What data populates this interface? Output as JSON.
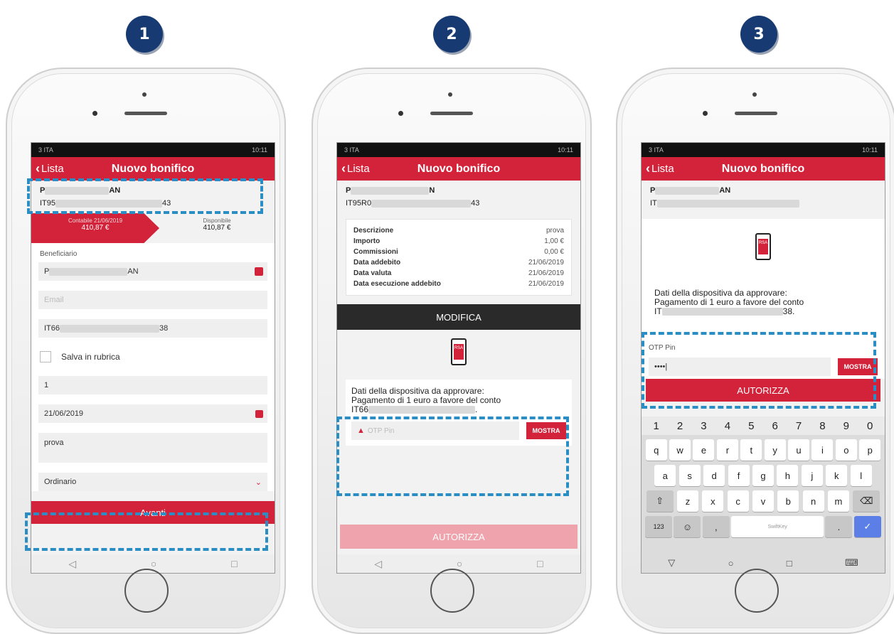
{
  "steps": [
    "1",
    "2",
    "3"
  ],
  "app": {
    "status_left": "3 ITA",
    "status_right": "10:11",
    "back_label": "Lista",
    "title": "Nuovo bonifico"
  },
  "screen1": {
    "account_name_start": "P",
    "account_name_end": "AN",
    "iban_start": "IT95",
    "iban_end": "43",
    "contabile_label": "Contabile 21/06/2019",
    "contabile_value": "410,87 €",
    "disponibile_label": "Disponibile",
    "disponibile_value": "410,87 €",
    "beneficiario_label": "Beneficiario",
    "beneficiario_value_start": "P",
    "beneficiario_value_end": "AN",
    "email_placeholder": "Email",
    "iban_field_start": "IT66",
    "iban_field_end": "38",
    "salva_label": "Salva in rubrica",
    "importo_value": "1",
    "date_value": "21/06/2019",
    "causale_value": "prova",
    "tipo_value": "Ordinario",
    "avanti_label": "Avanti"
  },
  "screen2": {
    "account_name_start": "P",
    "account_name_end": "N",
    "iban_start": "IT95R0",
    "iban_end": "43",
    "details": [
      {
        "k": "Descrizione",
        "v": "prova"
      },
      {
        "k": "Importo",
        "v": "1,00 €"
      },
      {
        "k": "Commissioni",
        "v": "0,00 €"
      },
      {
        "k": "Data addebito",
        "v": "21/06/2019"
      },
      {
        "k": "Data valuta",
        "v": "21/06/2019"
      },
      {
        "k": "Data esecuzione addebito",
        "v": "21/06/2019"
      }
    ],
    "modifica_label": "MODIFICA",
    "rsa_label": "RSA",
    "dispo_line1": "Dati della dispositiva da approvare:",
    "dispo_line2": "Pagamento di 1 euro a favore del conto",
    "dispo_line3_start": "IT66",
    "dispo_line3_end": ".",
    "otp_placeholder": "OTP Pin",
    "mostra_label": "MOSTRA",
    "autorizza_label": "AUTORIZZA"
  },
  "screen3": {
    "account_name_start": "P",
    "account_name_end": "AN",
    "iban_start": "IT",
    "rsa_label": "RSA",
    "dispo_line1": "Dati della dispositiva da approvare:",
    "dispo_line2": "Pagamento di 1 euro a favore del conto",
    "dispo_line3_start": "IT",
    "dispo_line3_end": "38.",
    "otp_label": "OTP Pin",
    "otp_value": "••••|",
    "mostra_label": "MOSTRA",
    "autorizza_label": "AUTORIZZA",
    "keyboard": {
      "numbers": [
        "1",
        "2",
        "3",
        "4",
        "5",
        "6",
        "7",
        "8",
        "9",
        "0"
      ],
      "row1": [
        "q",
        "w",
        "e",
        "r",
        "t",
        "y",
        "u",
        "i",
        "o",
        "p"
      ],
      "row2": [
        "a",
        "s",
        "d",
        "f",
        "g",
        "h",
        "j",
        "k",
        "l"
      ],
      "row3": [
        "z",
        "x",
        "c",
        "v",
        "b",
        "n",
        "m"
      ],
      "sym_label": "123",
      "space_label": "SwiftKey"
    }
  }
}
